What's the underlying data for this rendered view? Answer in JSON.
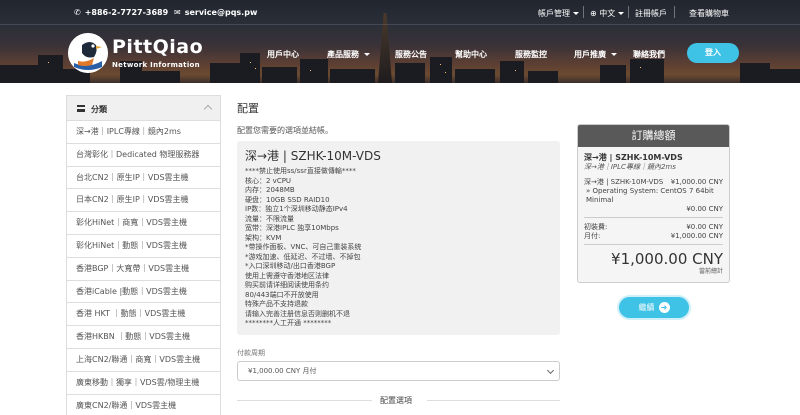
{
  "topbar": {
    "phone": "+886-2-7727-3689",
    "email": "service@pqs.pw",
    "account_menu": "帳戶管理",
    "language": "中文",
    "register": "註冊帳戶",
    "cart": "查看購物車"
  },
  "brand": {
    "name": "PittQiao",
    "subtitle": "Network Information"
  },
  "nav": {
    "items": [
      {
        "label": "用戶中心"
      },
      {
        "label": "產品服務"
      },
      {
        "label": "服務公告"
      },
      {
        "label": "幫助中心"
      },
      {
        "label": "服務監控"
      },
      {
        "label": "用戶推廣"
      },
      {
        "label": "聯絡我們"
      }
    ],
    "login": "登入"
  },
  "sidebar": {
    "title": "分類",
    "items": [
      {
        "label": "深→港｜IPLC專線｜鏡內2ms"
      },
      {
        "label": "台灣彰化｜Dedicated 物理服務器"
      },
      {
        "label": "台北CN2｜原生IP｜VDS雲主機"
      },
      {
        "label": "日本CN2｜原生IP｜VDS雲主機"
      },
      {
        "label": "彰化HiNet｜商寬｜VDS雲主機"
      },
      {
        "label": "彰化HiNet｜動態｜VDS雲主機"
      },
      {
        "label": "香港BGP｜大寬帶｜VDS雲主機"
      },
      {
        "label": "香港iCable |動態｜VDS雲主機"
      },
      {
        "label": "香港 HKT ｜動態｜VDS雲主機"
      },
      {
        "label": "香港HKBN ｜動態｜VDS雲主機"
      },
      {
        "label": "上海CN2/聯通｜商寬｜VDS雲主機"
      },
      {
        "label": "廣東移動｜獨享｜VDS雲/物理主機"
      },
      {
        "label": "廣東CN2/聯通｜VDS雲主機"
      }
    ]
  },
  "main": {
    "title": "配置",
    "subtitle": "配置您需要的選項並結帳。",
    "product": {
      "name": "深→港 | SZHK-10M-VDS",
      "lines": [
        "****禁止使用ss/ssr直接做傳輸****",
        "核心：2 vCPU",
        "内存：2048MB",
        "硬盘：10GB SSD RAID10",
        "IP数：独立1个深圳移动静态IPv4",
        "流量：不限流量",
        "宽带：深港IPLC 独享10Mbps",
        "架构：KVM",
        "*带操作面板、VNC、可自己重装系统",
        "*游戏加速、低延迟、不过墙、不掉包",
        "*入口深圳移动/出口香港BGP",
        "使用上需遵守香港地区法律",
        "购买前请详细阅读使用条约",
        "80/443端口不开放使用",
        "特殊产品不支持退款",
        "请输入完善注册信息否则删机不退",
        "********人工开通 ********"
      ]
    },
    "billing_label": "付款周期",
    "billing_value": "¥1,000.00 CNY 月付",
    "config_title": "配置選項"
  },
  "summary": {
    "title": "訂購總額",
    "product_name": "深→港 | SZHK-10M-VDS",
    "product_group": "深→港｜IPLC專線｜鏡內2ms",
    "line_label": "深→港 | SZHK-10M-VDS",
    "line_price": "¥1,000.00 CNY",
    "os_line1": "» Operating System: CentOS 7 64bit",
    "os_line2": "Minimal",
    "os_price": "¥0.00 CNY",
    "setup_label": "初裝費:",
    "setup_price": "¥0.00 CNY",
    "monthly_label": "月付:",
    "monthly_price": "¥1,000.00 CNY",
    "total": "¥1,000.00 CNY",
    "total_label": "當前總計"
  },
  "continue_label": "繼續",
  "colors": {
    "accent": "#3ec2e6",
    "summary_header": "#595959"
  }
}
